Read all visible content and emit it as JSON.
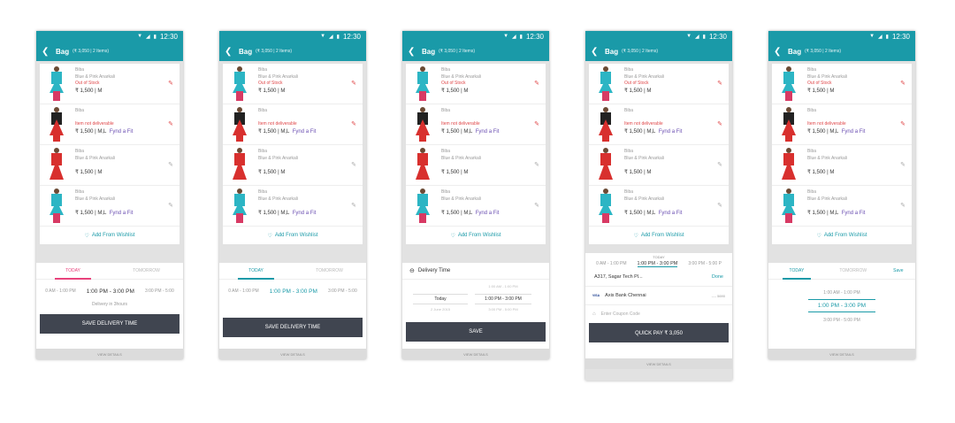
{
  "status": {
    "time": "12:30"
  },
  "appbar": {
    "title": "Bag",
    "subtitle": "(₹ 3,050 | 2 Items)"
  },
  "items": [
    {
      "brand": "Biba",
      "name": "Blue & Pink Anarkali",
      "note": "Out of Stock",
      "price": "₹ 1,500  |  M",
      "fit": ""
    },
    {
      "brand": "Biba",
      "name": "",
      "note": "Item not deliverable",
      "price": "₹ 1,500  |  M,L",
      "fit": "Fynd a Fit"
    },
    {
      "brand": "Biba",
      "name": "Blue & Pink Anarkali",
      "note": "",
      "price": "₹ 1,500  |  M",
      "fit": ""
    },
    {
      "brand": "Biba",
      "name": "Blue & Pink Anarkali",
      "note": "",
      "price": "₹ 1,500  |  M,L",
      "fit": "Fynd a Fit"
    }
  ],
  "wishlist": "Add From Wishlist",
  "colors": {
    "teal": "#1a9aa8",
    "pink": "#e8427c",
    "error": "#e0484a",
    "dark_button": "#404550",
    "fit": "#6b4fb2"
  },
  "screen1": {
    "tab_today": "TODAY",
    "tab_tomorrow": "TOMORROW",
    "slot_prev": "0 AM - 1:00 PM",
    "slot_sel": "1:00 PM - 3:00 PM",
    "slot_next": "3:00 PM - 5:00",
    "hint": "Delivery in 3hours",
    "button": "SAVE DELIVERY TIME",
    "view": "VIEW DETAILS"
  },
  "screen2": {
    "tab_today": "TODAY",
    "tab_tomorrow": "TOMORROW",
    "slot_prev": "0 AM - 1:00 PM",
    "slot_sel": "1:00 PM - 3:00 PM",
    "slot_next": "3:00 PM - 5:00",
    "button": "SAVE DELIVERY TIME",
    "view": "VIEW DETAILS"
  },
  "screen3": {
    "header": "Delivery Time",
    "date_sel": "Today",
    "date_next": "2 June 2015",
    "time_prev": "1:00 AM - 1:00 PM",
    "time_sel": "1:00 PM - 3:00 PM",
    "time_next": "3:00 PM - 5:00 PM",
    "button": "SAVE",
    "view": "VIEW DETAILS"
  },
  "screen4": {
    "today": "TODAY",
    "slot_prev": "0 AM - 1:00 PM",
    "slot_sel": "1:00 PM - 3:00 PM",
    "slot_next": "3:00 PM - 5:00 P",
    "address": "A317, Sagar Tech Pl...",
    "done": "Done",
    "card_brand": "VISA",
    "bank": "Axis Bank Chennai",
    "card_num": "---- 5690",
    "coupon": "Enter Coupon Code",
    "button": "QUICK PAY ₹ 3,050",
    "view": "VIEW DETAILS"
  },
  "screen5": {
    "tab_today": "TODAY",
    "tab_tomorrow": "TOMORROW",
    "save": "Save",
    "slot_prev": "1:00 AM - 1:00 PM",
    "slot_sel": "1:00 PM - 3:00 PM",
    "slot_next": "3:00 PM - 5:00 PM",
    "view": "VIEW DETAILS"
  }
}
